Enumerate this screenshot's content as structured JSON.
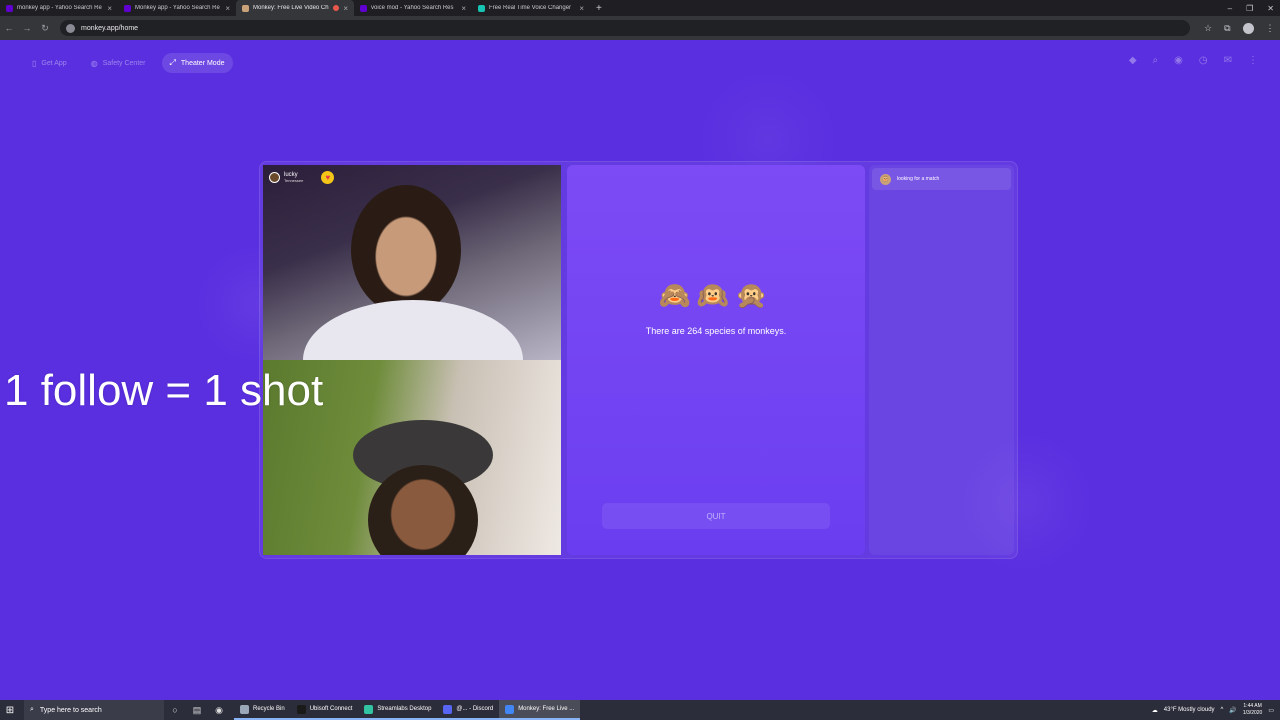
{
  "browser": {
    "tabs": [
      {
        "title": "monkey app - Yahoo Search Re",
        "favicon_color": "#6001d2",
        "active": false
      },
      {
        "title": "Monkey app - Yahoo Search Re",
        "favicon_color": "#6001d2",
        "active": false
      },
      {
        "title": "Monkey: Free Live Video Ch",
        "favicon_color": "#c9a27a",
        "active": true,
        "recording": true
      },
      {
        "title": "voice mod - Yahoo Search Res",
        "favicon_color": "#6001d2",
        "active": false
      },
      {
        "title": "Free Real Time Voice Changer",
        "favicon_color": "#17c3b2",
        "active": false
      }
    ],
    "new_tab_symbol": "+",
    "window_controls": [
      "–",
      "❐",
      "✕"
    ],
    "url": "monkey.app/home"
  },
  "nav": {
    "items": [
      {
        "label": "Get App",
        "icon": "▯",
        "active": false
      },
      {
        "label": "Safety Center",
        "icon": "◍",
        "active": false
      },
      {
        "label": "Theater Mode",
        "icon": "⤢",
        "active": true
      }
    ],
    "icons": [
      "◆",
      "⌕",
      "◉",
      "◷",
      "✉",
      "⋮"
    ]
  },
  "video": {
    "remote_user": {
      "name": "lucky",
      "location": "Tennessee",
      "heart": "♥"
    }
  },
  "center": {
    "monkeys": "🙈🙉🙊",
    "fact": "There are 264 species of monkeys.",
    "quit_label": "QUIT"
  },
  "chat": {
    "status": "looking for a match",
    "status_icon": "🐵"
  },
  "overlay_text": "1 follow = 1 shot",
  "taskbar": {
    "search_placeholder": "Type here to search",
    "apps": [
      {
        "label": "Recycle Bin",
        "color": "#9aa7b8"
      },
      {
        "label": "Ubisoft Connect",
        "color": "#1a1a1a"
      },
      {
        "label": "Streamlabs Desktop",
        "color": "#31c3a2"
      },
      {
        "label": "@... - Discord",
        "color": "#5865f2"
      },
      {
        "label": "Monkey: Free Live ...",
        "color": "#4285f4"
      }
    ],
    "weather": "43°F  Mostly cloudy",
    "time": "1:44 AM",
    "date": "1/3/2020"
  }
}
